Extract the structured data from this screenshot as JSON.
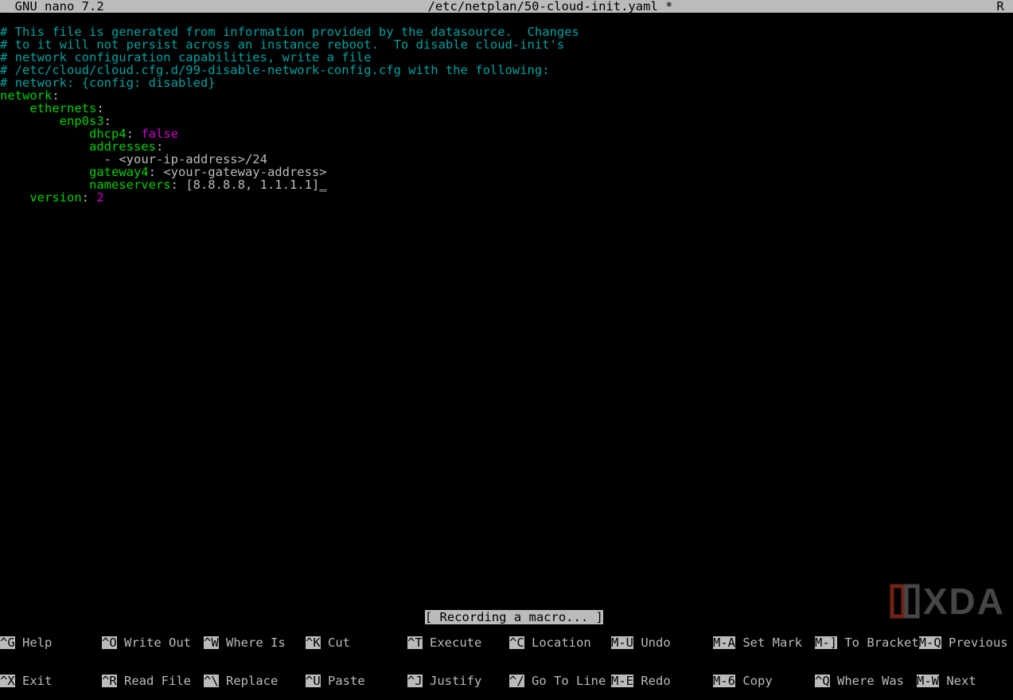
{
  "title": {
    "app": "  GNU nano 7.2",
    "file": "/etc/netplan/50-cloud-init.yaml *",
    "flag": "R "
  },
  "file": {
    "comments": [
      "# This file is generated from information provided by the datasource.  Changes",
      "# to it will not persist across an instance reboot.  To disable cloud-init's",
      "# network configuration capabilities, write a file",
      "# /etc/cloud/cloud.cfg.d/99-disable-network-config.cfg with the following:",
      "# network: {config: disabled}"
    ],
    "yaml": {
      "k_network": "network",
      "k_ethernets": "ethernets",
      "k_iface": "enp0s3",
      "k_dhcp4": "dhcp4",
      "v_dhcp4": "false",
      "k_addresses": "addresses",
      "v_address_item": "- <your-ip-address>/24",
      "k_gateway4": "gateway4",
      "v_gateway4": "<your-gateway-address>",
      "k_nameservers": "nameservers",
      "v_nameservers": "[8.8.8.8, 1.1.1.1]",
      "k_version": "version",
      "v_version": "2"
    }
  },
  "status": {
    "bracket_open": "[ ",
    "text": "Recording a macro...",
    "bracket_close": " ]"
  },
  "footer": {
    "row1": [
      {
        "key": "^G",
        "label": " Help"
      },
      {
        "key": "^O",
        "label": " Write Out"
      },
      {
        "key": "^W",
        "label": " Where Is"
      },
      {
        "key": "^K",
        "label": " Cut"
      },
      {
        "key": "^T",
        "label": " Execute"
      },
      {
        "key": "^C",
        "label": " Location"
      },
      {
        "key": "M-U",
        "label": " Undo"
      },
      {
        "key": "M-A",
        "label": " Set Mark"
      },
      {
        "key": "M-]",
        "label": " To Bracket"
      },
      {
        "key": "M-Q",
        "label": " Previous"
      }
    ],
    "row2": [
      {
        "key": "^X",
        "label": " Exit"
      },
      {
        "key": "^R",
        "label": " Read File"
      },
      {
        "key": "^\\",
        "label": " Replace"
      },
      {
        "key": "^U",
        "label": " Paste"
      },
      {
        "key": "^J",
        "label": " Justify"
      },
      {
        "key": "^/",
        "label": " Go To Line"
      },
      {
        "key": "M-E",
        "label": " Redo"
      },
      {
        "key": "M-6",
        "label": " Copy"
      },
      {
        "key": "^Q",
        "label": " Where Was"
      },
      {
        "key": "M-W",
        "label": " Next"
      }
    ]
  },
  "watermark": "XDA"
}
